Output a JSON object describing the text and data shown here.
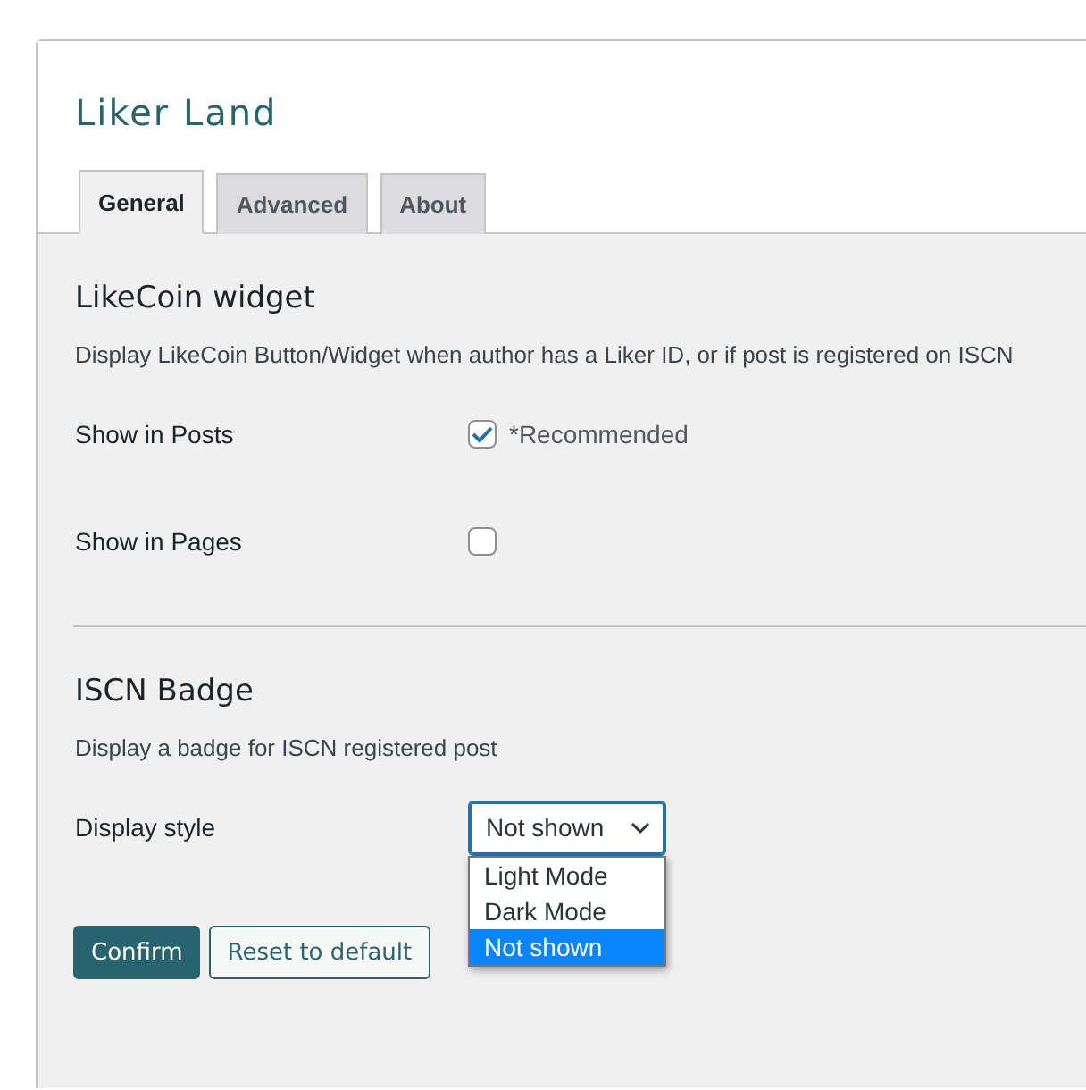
{
  "logo": {
    "text": "Liker Land"
  },
  "tabs": [
    {
      "label": "General",
      "selected": true
    },
    {
      "label": "Advanced",
      "selected": false
    },
    {
      "label": "About",
      "selected": false
    }
  ],
  "sections": [
    {
      "title": "LikeCoin widget",
      "description": "Display LikeCoin Button/Widget when author has a Liker ID, or if post is registered on ISCN",
      "fields": [
        {
          "kind": "checkbox",
          "label": "Show in Posts",
          "checked": true,
          "note": "*Recommended"
        },
        {
          "kind": "checkbox",
          "label": "Show in Pages",
          "checked": false
        }
      ]
    },
    {
      "title": "ISCN Badge",
      "description": "Display a badge for ISCN registered post",
      "fields": [
        {
          "kind": "select",
          "label": "Display style",
          "value": "Not shown",
          "expanded": true,
          "options": [
            {
              "label": "Light Mode",
              "selected": false
            },
            {
              "label": "Dark Mode",
              "selected": false
            },
            {
              "label": "Not shown",
              "selected": true
            }
          ]
        }
      ]
    }
  ],
  "buttons": [
    {
      "kind": "primary",
      "label": "Confirm"
    },
    {
      "kind": "secondary",
      "label": "Reset to default"
    }
  ]
}
